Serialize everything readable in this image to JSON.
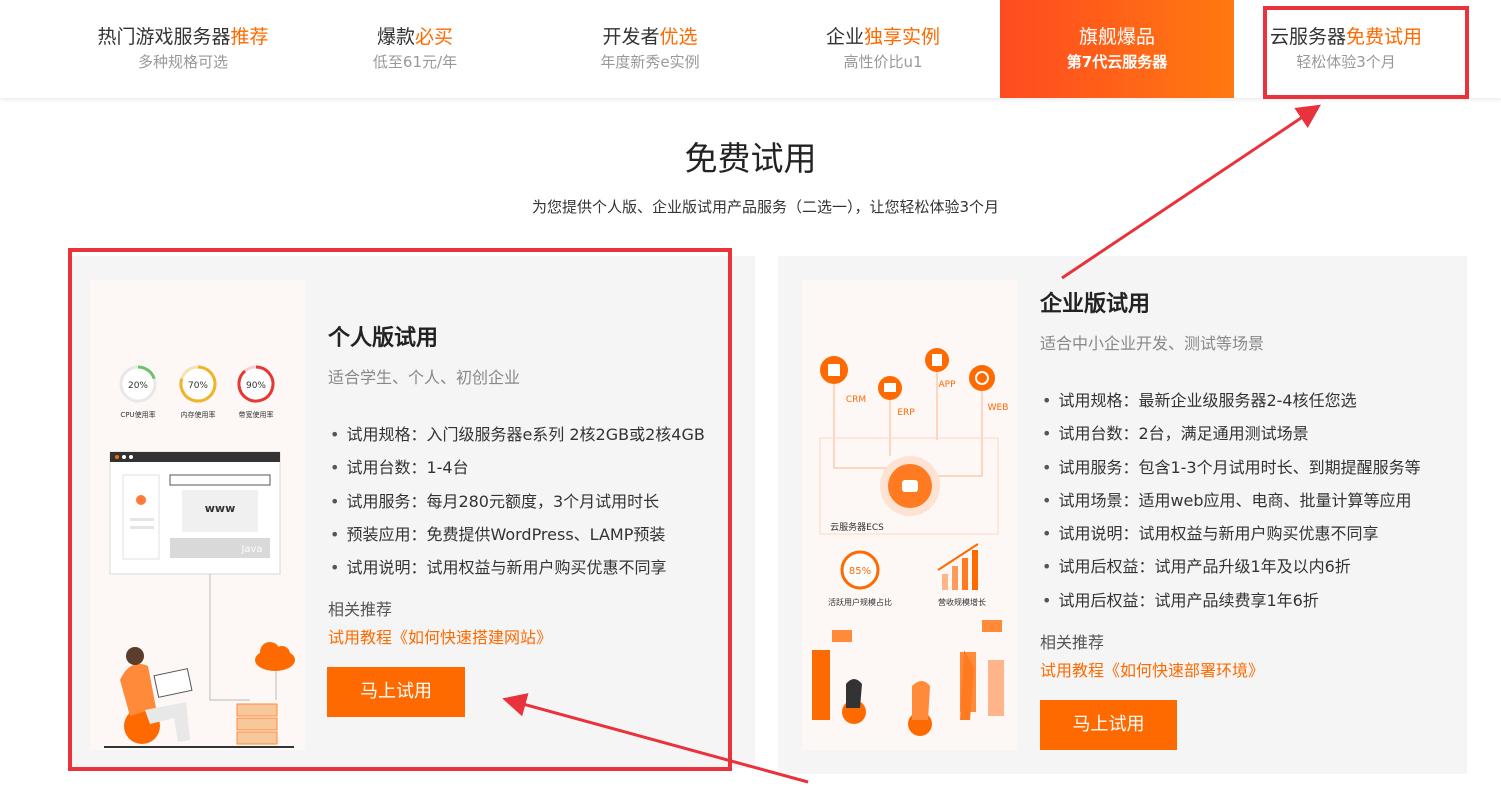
{
  "nav": {
    "items": [
      {
        "title_plain": "热门游戏服务器",
        "title_highlight": "推荐",
        "subtitle": "多种规格可选"
      },
      {
        "title_plain": "爆款",
        "title_highlight": "必买",
        "subtitle": "低至61元/年"
      },
      {
        "title_plain": "开发者",
        "title_highlight": "优选",
        "subtitle": "年度新秀e实例"
      },
      {
        "title_plain": "企业",
        "title_highlight": "独享实例",
        "subtitle": "高性价比u1"
      },
      {
        "title_plain": "旗舰爆品",
        "title_highlight": "",
        "subtitle": "第7代云服务器"
      },
      {
        "title_plain": "云服务器",
        "title_highlight": "免费试用",
        "subtitle": "轻松体验3个月"
      }
    ]
  },
  "section": {
    "title": "免费试用",
    "subtitle": "为您提供个人版、企业版试用产品服务（二选一），让您轻松体验3个月"
  },
  "personal": {
    "title": "个人版试用",
    "desc": "适合学生、个人、初创企业",
    "features": [
      "试用规格：入门级服务器e系列 2核2GB或2核4GB",
      "试用台数：1-4台",
      "试用服务：每月280元额度，3个月试用时长",
      "预装应用：免费提供WordPress、LAMP预装",
      "试用说明：试用权益与新用户购买优惠不同享"
    ],
    "related_label": "相关推荐",
    "tutorial": "试用教程《如何快速搭建网站》",
    "button": "马上试用",
    "illustration": {
      "gauges": [
        {
          "value": "20%",
          "label": "CPU使用率",
          "fraction": 0.2
        },
        {
          "value": "70%",
          "label": "内存使用率",
          "fraction": 0.7
        },
        {
          "value": "90%",
          "label": "带宽使用率",
          "fraction": 0.9
        }
      ],
      "www": "www",
      "java": "Java"
    }
  },
  "enterprise": {
    "title": "企业版试用",
    "desc": "适合中小企业开发、测试等场景",
    "features": [
      "试用规格：最新企业级服务器2-4核任您选",
      "试用台数：2台，满足通用测试场景",
      "试用服务：包含1-3个月试用时长、到期提醒服务等",
      "试用场景：适用web应用、电商、批量计算等应用",
      "试用说明：试用权益与新用户购买优惠不同享",
      "试用后权益：试用产品升级1年及以内6折",
      "试用后权益：试用产品续费享1年6折"
    ],
    "related_label": "相关推荐",
    "tutorial": "试用教程《如何快速部署环境》",
    "button": "马上试用",
    "illustration": {
      "nodes": [
        "CRM",
        "ERP",
        "APP",
        "WEB"
      ],
      "ecs_label": "云服务器ECS",
      "stat_value": "85%",
      "stat_label": "活跃用户规模占比",
      "growth_label": "营收规模增长"
    }
  },
  "colors": {
    "accent": "#ff6a00",
    "annotation": "#e8323c",
    "card_bg": "#f5f5f5"
  }
}
